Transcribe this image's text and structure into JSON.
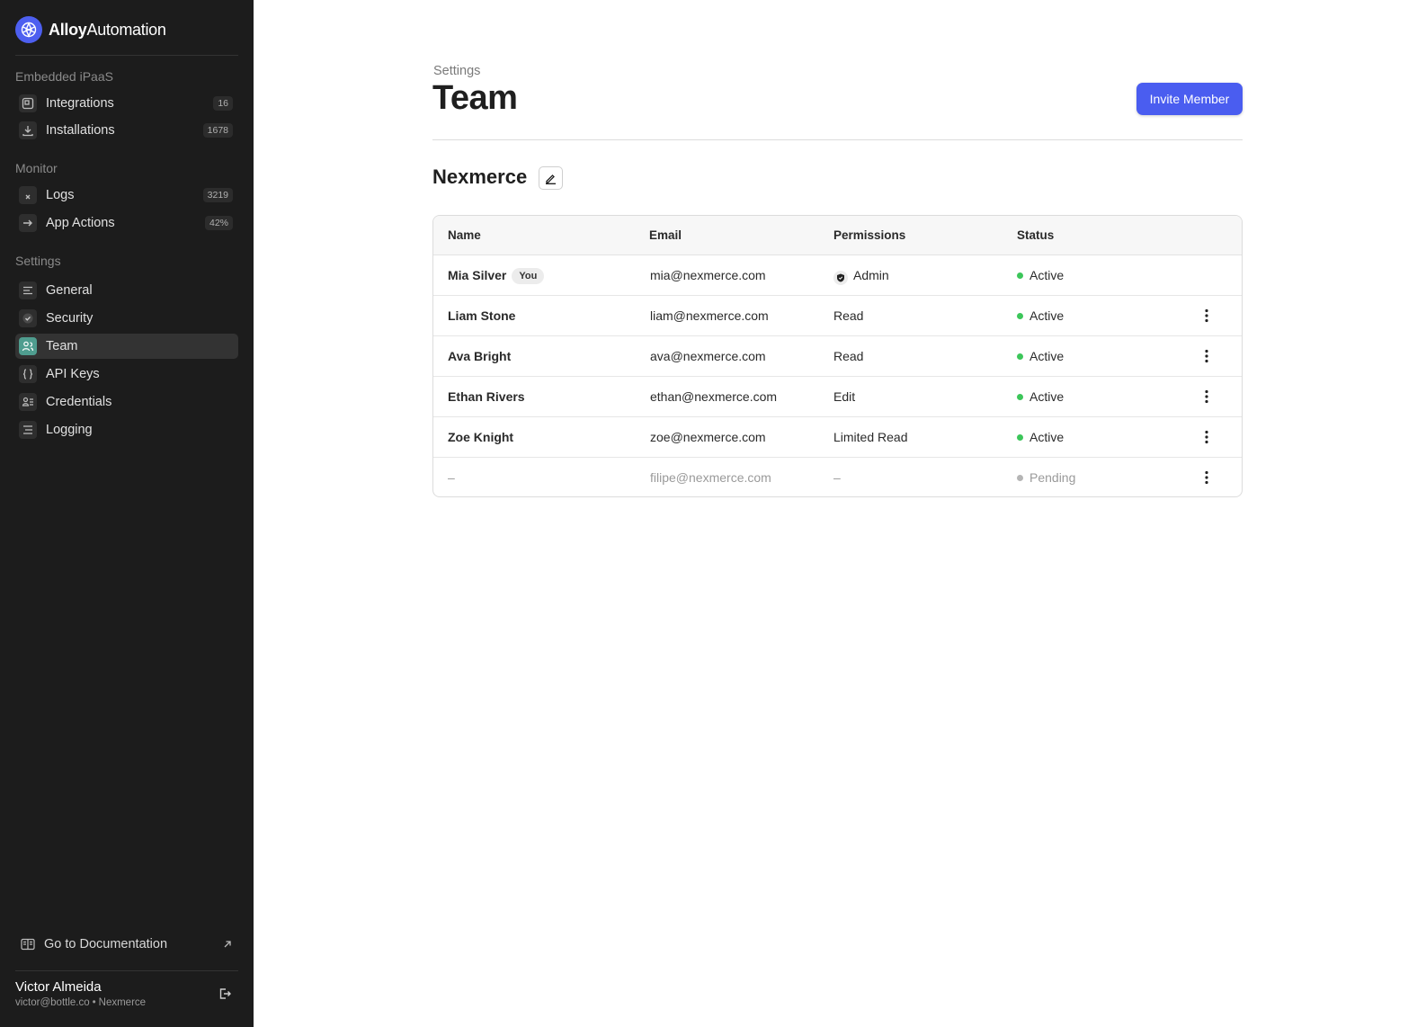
{
  "brand": {
    "name_bold": "Alloy",
    "name_light": "Automation",
    "accent": "#4d5ff0"
  },
  "sidebar": {
    "sections": [
      {
        "label": "Embedded iPaaS"
      },
      {
        "label": "Monitor"
      },
      {
        "label": "Settings"
      }
    ],
    "items": [
      {
        "label": "Integrations",
        "count": "16",
        "icon": "integrations-icon"
      },
      {
        "label": "Installations",
        "count": "1678",
        "icon": "download-icon"
      },
      {
        "label": "Logs",
        "count": "3219",
        "icon": "logs-icon"
      },
      {
        "label": "App Actions",
        "count": "42%",
        "icon": "arrow-right-icon"
      },
      {
        "label": "General",
        "icon": "list-icon"
      },
      {
        "label": "Security",
        "icon": "shield-check-icon"
      },
      {
        "label": "Team",
        "icon": "team-icon",
        "active": true
      },
      {
        "label": "API Keys",
        "icon": "braces-icon"
      },
      {
        "label": "Credentials",
        "icon": "credentials-icon"
      },
      {
        "label": "Logging",
        "icon": "logging-icon"
      }
    ],
    "doc_link": "Go to Documentation",
    "user": {
      "name": "Victor Almeida",
      "email": "victor@bottle.co",
      "separator": "•",
      "org": "Nexmerce"
    }
  },
  "main": {
    "breadcrumb": "Settings",
    "title": "Team",
    "invite_button": "Invite Member",
    "org_name": "Nexmerce",
    "table": {
      "headers": [
        "Name",
        "Email",
        "Permissions",
        "Status"
      ],
      "rows": [
        {
          "name": "Mia Silver",
          "badge": "You",
          "email": "mia@nexmerce.com",
          "permission": "Admin",
          "status": "Active"
        },
        {
          "name": "Liam Stone",
          "email": "liam@nexmerce.com",
          "permission": "Read",
          "status": "Active"
        },
        {
          "name": "Ava Bright",
          "email": "ava@nexmerce.com",
          "permission": "Read",
          "status": "Active"
        },
        {
          "name": "Ethan Rivers",
          "email": "ethan@nexmerce.com",
          "permission": "Edit",
          "status": "Active"
        },
        {
          "name": "Zoe Knight",
          "email": "zoe@nexmerce.com",
          "permission": "Limited Read",
          "status": "Active"
        },
        {
          "name": "–",
          "email": "filipe@nexmerce.com",
          "permission": "–",
          "status": "Pending"
        }
      ]
    },
    "colors": {
      "active": "#3cc65a",
      "pending": "#b5b5b5",
      "primary": "#4a5df0"
    }
  }
}
